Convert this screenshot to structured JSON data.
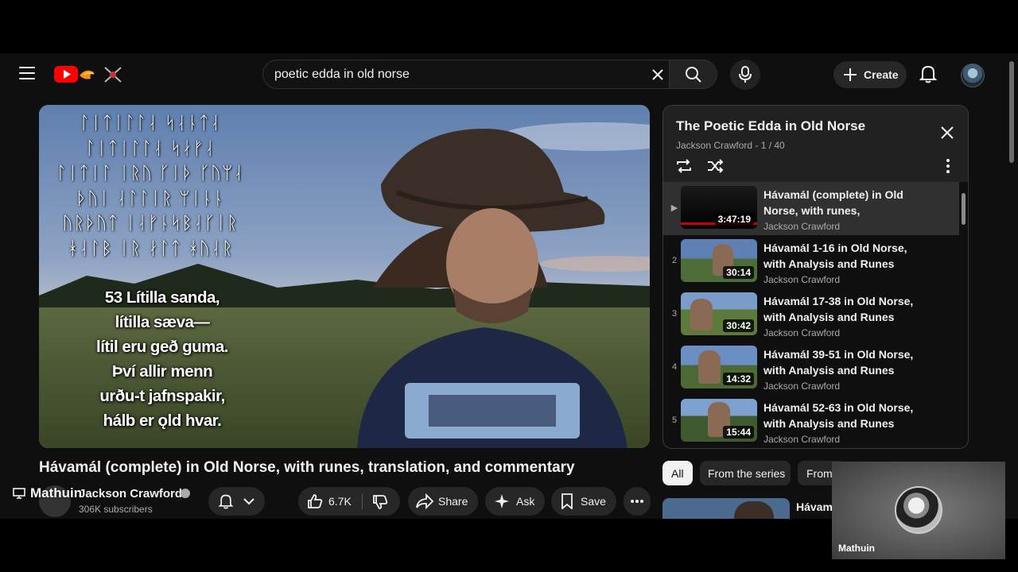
{
  "header": {
    "search": {
      "value": "poetic edda in old norse",
      "placeholder": "Search"
    },
    "create_label": "Create"
  },
  "video": {
    "runes": "ᛚᛁᛏᛁᛚᛚᛆ ᛋᛆᚿᛏᛆ\nᛚᛁᛏᛁᛚᛚᛆ ᛋᛅᚠᛆ\nᛚᛁᛏᛁᛚ ᛁᚱᚢ ᚴᛁᚦ ᚴᚢᛘᛆ\nᚦᚢᛁ ᛆᛚᛚᛁᚱ ᛘᛁᚿᚿ\nᚢᚱᚦᚢᛏ ᛁᛆᚠᚿᛋᛒᛆᚴᛁᚱ\nᚼᛆᛚᛒ ᛁᚱ ᛅᛚᛏ ᚼᚢᛆᚱ",
    "stanza": [
      "53 Lítilla sanda,",
      "lítilla sæva—",
      "lítil eru geð guma.",
      "Því allir menn",
      "urðu-t jafnspakir,",
      "hálb er ǫld hvar."
    ],
    "title": "Hávamál (complete) in Old Norse, with runes, translation, and commentary",
    "channel": "Jackson Crawford",
    "subscribers": "306K subscribers",
    "likes": "6.7K",
    "share_label": "Share",
    "ask_label": "Ask",
    "save_label": "Save"
  },
  "playlist": {
    "title": "The Poetic Edda in Old Norse",
    "subtitle": "Jackson Crawford - 1 / 40",
    "items": [
      {
        "index": "▶",
        "title": "Hávamál (complete) in Old Norse, with runes, translation,...",
        "channel": "Jackson Crawford",
        "duration": "3:47:19"
      },
      {
        "index": "2",
        "title": "Hávamál 1-16 in Old Norse, with Analysis and Runes",
        "channel": "Jackson Crawford",
        "duration": "30:14"
      },
      {
        "index": "3",
        "title": "Hávamál 17-38 in Old Norse, with Analysis and Runes",
        "channel": "Jackson Crawford",
        "duration": "30:42"
      },
      {
        "index": "4",
        "title": "Hávamál 39-51 in Old Norse, with Analysis and Runes",
        "channel": "Jackson Crawford",
        "duration": "14:32"
      },
      {
        "index": "5",
        "title": "Hávamál 52-63 in Old Norse, with Analysis and Runes",
        "channel": "Jackson Crawford",
        "duration": "15:44"
      }
    ]
  },
  "chips": [
    "All",
    "From the series",
    "From"
  ],
  "recommendation": {
    "title": "Hávama"
  },
  "overlay": {
    "presenter": "Mathuin",
    "camera_name": "Mathuin"
  },
  "icons": {
    "menu": "hamburger-icon",
    "clear": "close-icon",
    "search": "search-icon",
    "mic": "mic-icon",
    "create": "plus-icon",
    "notifications": "bell-icon",
    "like": "thumbs-up-icon",
    "dislike": "thumbs-down-icon"
  },
  "colors": {
    "brand": "#ff0000",
    "background": "#0f0f0f",
    "surface": "#272727"
  }
}
